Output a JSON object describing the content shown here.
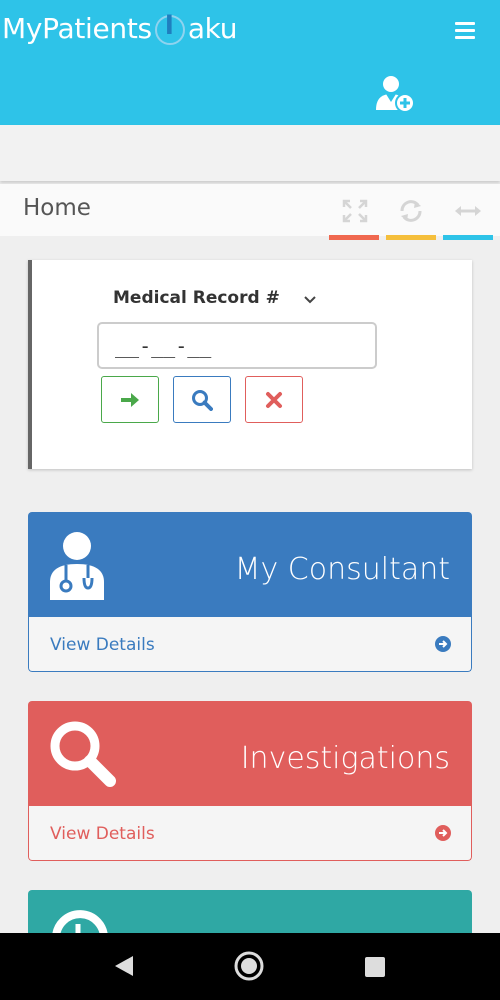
{
  "header": {
    "logo_left": "MyPatients",
    "logo_right": "aku",
    "menu_icon": "hamburger-icon",
    "add_icon": "user-md-plus-icon"
  },
  "breadcrumb": {
    "title": "Home",
    "tools": [
      "expand-icon",
      "refresh-icon",
      "collapse-horizontal-icon"
    ],
    "strip_colors": [
      "#f0684f",
      "#f5bf3c",
      "#2ec3e8"
    ]
  },
  "search": {
    "field_label": "Medical Record #",
    "input_value": "__-__-__",
    "buttons": [
      "go-arrow-icon",
      "search-icon",
      "clear-icon"
    ]
  },
  "panels": [
    {
      "title": "My Consultant",
      "link": "View Details",
      "color": "#3a7bbf",
      "icon": "doctor-icon"
    },
    {
      "title": "Investigations",
      "link": "View Details",
      "color": "#e05e5c",
      "icon": "search-icon"
    },
    {
      "title": "",
      "link": "",
      "color": "#2fa8a4",
      "icon": "history-icon"
    }
  ],
  "colors": {
    "header": "#2ec3e8",
    "go": "#4aa84a",
    "search": "#3a7bbf",
    "clear": "#e05e5c"
  }
}
